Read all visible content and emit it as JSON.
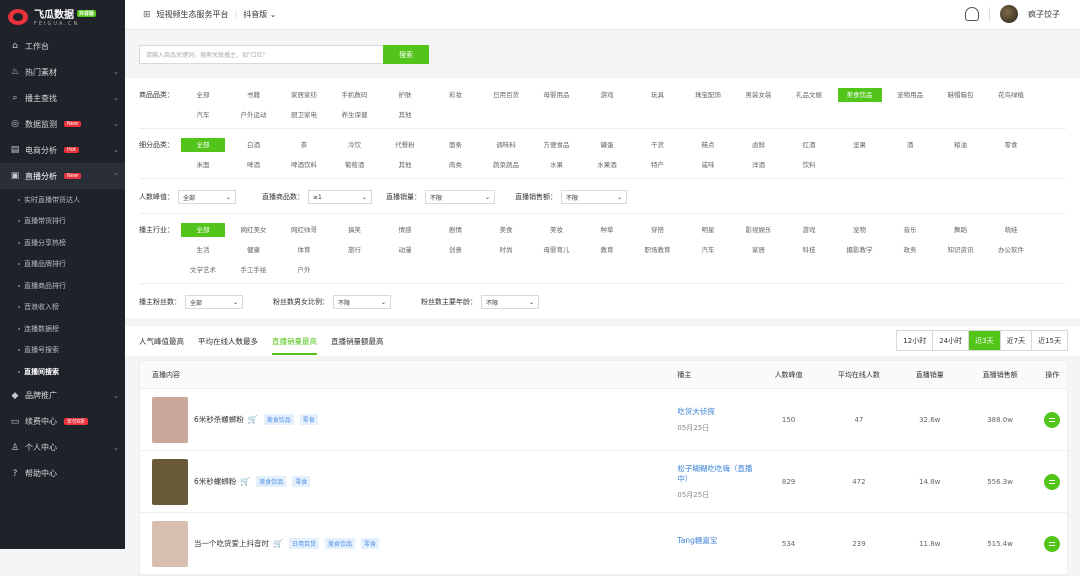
{
  "brand": {
    "cn": "飞瓜数据",
    "badge": "抖音版",
    "en": "FEIGUA.CN"
  },
  "topbar": {
    "platform": "短视频生态服务平台",
    "version": "抖音版",
    "username": "疯子饺子"
  },
  "nav": [
    {
      "label": "工作台",
      "icon": "home-icon",
      "glyph": "⌂",
      "arrow": ""
    },
    {
      "label": "热门素材",
      "icon": "fire-icon",
      "glyph": "♨",
      "arrow": "⌄"
    },
    {
      "label": "播主查找",
      "icon": "search-icon",
      "glyph": "⌕",
      "arrow": "⌄"
    },
    {
      "label": "数据监测",
      "icon": "monitor-icon",
      "glyph": "◎",
      "arrow": "⌄",
      "tag": "New"
    },
    {
      "label": "电商分析",
      "icon": "cart-icon",
      "glyph": "▤",
      "arrow": "⌄",
      "tag": "Hot"
    },
    {
      "label": "直播分析",
      "icon": "live-icon",
      "glyph": "▣",
      "arrow": "⌃",
      "tag": "New"
    }
  ],
  "subnav": [
    "实时直播带货达人",
    "直播带货排行",
    "直播分享热榜",
    "直播品牌排行",
    "直播商品排行",
    "音浪收入榜",
    "连播数据榜",
    "直播号搜索",
    "直播间搜索"
  ],
  "nav_bottom": [
    {
      "label": "品牌推广",
      "icon": "diamond-icon",
      "glyph": "◆",
      "arrow": "⌄"
    },
    {
      "label": "续费中心",
      "icon": "renew-icon",
      "glyph": "▭",
      "arrow": "",
      "tag": "年付6折"
    },
    {
      "label": "个人中心",
      "icon": "user-icon",
      "glyph": "♙",
      "arrow": "⌄"
    },
    {
      "label": "帮助中心",
      "icon": "help-icon",
      "glyph": "?",
      "arrow": ""
    }
  ],
  "search": {
    "placeholder": "请输入商品关键词，搜索关联播主，如\"口红\"",
    "button": "搜索"
  },
  "filters": {
    "category_label": "商品品类：",
    "category": [
      "全部",
      "书籍",
      "家居家纺",
      "手机数码",
      "护肤",
      "彩妆",
      "日用百货",
      "母婴用品",
      "游戏",
      "玩具",
      "珠宝配饰",
      "男装女装",
      "礼品文娱",
      "美食饮品",
      "宠物用品",
      "鞋帽箱包",
      "花鸟绿植",
      "汽车",
      "户外运动",
      "厨卫家电",
      "养生保健",
      "其他"
    ],
    "category_selected": 13,
    "sub_label": "细分品类：",
    "sub": [
      "全部",
      "白酒",
      "茶",
      "冷饮",
      "代餐粉",
      "面条",
      "调味料",
      "方便食品",
      "罐蛋",
      "干货",
      "糕点",
      "卤鲜",
      "红酒",
      "坚果",
      "酒",
      "粮油",
      "零食",
      "米面",
      "啤酒",
      "啤酒饮料",
      "葡萄酒",
      "其他",
      "肉类",
      "蔬菜蔬品",
      "水果",
      "水果酒",
      "特产",
      "咸味",
      "洋酒",
      "饮料"
    ],
    "sub_selected": 0,
    "peak_label": "人数峰值：",
    "peak_value": "全部",
    "goods_label": "直播商品数：",
    "goods_value": "≥1",
    "sales_label": "直播销量：",
    "sales_value": "不限",
    "amount_label": "直播销售额：",
    "amount_value": "不限",
    "industry_label": "播主行业：",
    "industry": [
      "全部",
      "网红美女",
      "网红帅哥",
      "搞笑",
      "情感",
      "剧情",
      "美食",
      "美妆",
      "种草",
      "穿搭",
      "明星",
      "影视娱乐",
      "游戏",
      "宠物",
      "音乐",
      "舞蹈",
      "萌娃",
      "生活",
      "健康",
      "体育",
      "旅行",
      "动漫",
      "创意",
      "时尚",
      "母婴育儿",
      "教育",
      "职场教育",
      "汽车",
      "家居",
      "科技",
      "摄影教学",
      "政务",
      "知识资讯",
      "办公软件",
      "文学艺术",
      "手工手绘",
      "户外"
    ],
    "industry_selected": 0,
    "fans_label": "播主粉丝数：",
    "fans_value": "全部",
    "gender_label": "粉丝数男女比例：",
    "gender_value": "不限",
    "age_label": "粉丝数主要年龄：",
    "age_value": "不限"
  },
  "tabs": [
    "人气峰值最高",
    "平均在线人数最多",
    "直播销量最高",
    "直播销量额最高"
  ],
  "tab_selected": 2,
  "time_tabs": [
    "12小时",
    "24小时",
    "近3天",
    "近7天",
    "近15天"
  ],
  "time_selected": 2,
  "table": {
    "headers": [
      "直播内容",
      "播主",
      "人数峰值",
      "平均在线人数",
      "直播销量",
      "直播销售额",
      "操作"
    ],
    "rows": [
      {
        "title": "6米秒杀螺蛳粉",
        "tags": [
          "美食饮品",
          "零食"
        ],
        "anchor": "吃货大侦探",
        "date": "05月25日",
        "peak": "150",
        "avg": "47",
        "sales": "32.6w",
        "amount": "388.0w",
        "thumb": "#c9a79a"
      },
      {
        "title": "6米秒螺蛳粉",
        "tags": [
          "美食饮品",
          "零食"
        ],
        "anchor": "松子糊糊吃吃嗨（直播中）",
        "date": "05月25日",
        "peak": "829",
        "avg": "472",
        "sales": "14.8w",
        "amount": "556.3w",
        "thumb": "#6b5a3a"
      },
      {
        "title": "当一个吃货爱上抖音时",
        "tags": [
          "日用百货",
          "美食饮品",
          "零食"
        ],
        "anchor": "Tang糖嘉宝",
        "date": "",
        "peak": "534",
        "avg": "239",
        "sales": "11.8w",
        "amount": "515.4w",
        "thumb": "#d8c0b0"
      }
    ]
  }
}
